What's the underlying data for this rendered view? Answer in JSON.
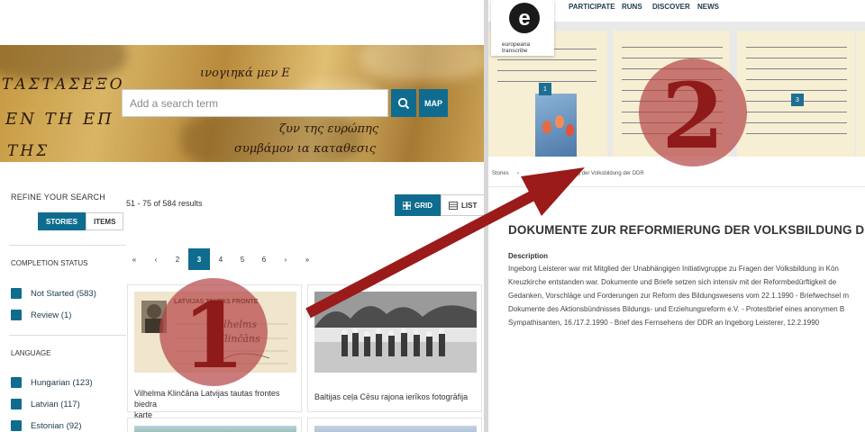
{
  "left": {
    "hero": {
      "handwriting": [
        "ΤΑΣΤΑΣΕΞΟ",
        "ΕΝ ΤΗ ΕΠ",
        "ΤΗΣ",
        "ινογιηκά μεν Ε",
        "ζυν της ευρώπης",
        "συμβάμον ια καταθεσις"
      ]
    },
    "search": {
      "placeholder": "Add a search term",
      "search_icon": "magnifier-icon",
      "map_label": "MAP"
    },
    "sidebar": {
      "refine_title": "REFINE YOUR SEARCH",
      "toggle": {
        "stories": "STORIES",
        "items": "ITEMS"
      },
      "completion_title": "COMPLETION STATUS",
      "completion": [
        {
          "label": "Not Started (583)"
        },
        {
          "label": "Review (1)"
        }
      ],
      "language_title": "LANGUAGE",
      "languages": [
        {
          "label": "Hungarian (123)"
        },
        {
          "label": "Latvian (117)"
        },
        {
          "label": "Estonian (92)"
        }
      ]
    },
    "results": {
      "count": "51 - 75 of 584 results",
      "grid_label": "GRID",
      "list_label": "LIST",
      "pagination": [
        "«",
        "‹",
        "2",
        "3",
        "4",
        "5",
        "6",
        "›",
        "»"
      ],
      "current_page": "3",
      "cards": [
        {
          "title_line1": "Vilhelma Klinčāna Latvijas tautas frontes biedra",
          "title_line2": "karte",
          "thumb_text": [
            "LATVIJAS TAUTAS FRONTE",
            "Vilhelms",
            "Klinčāns"
          ]
        },
        {
          "title_line1": "Baltijas ceļa Cēsu rajona ierīkos fotogrāfija",
          "title_line2": ""
        }
      ]
    },
    "annotation_number": "1"
  },
  "right": {
    "logo": {
      "line1": "europeana",
      "line2": "transcribe"
    },
    "nav": [
      "PARTICIPATE",
      "RUNS",
      "DISCOVER",
      "NEWS"
    ],
    "gallery_badges": [
      "1",
      "3"
    ],
    "breadcrumb": {
      "root": "Stories",
      "sep": "›",
      "current": "…rung der Volksbildung der DDR"
    },
    "story_title": "DOKUMENTE ZUR REFORMIERUNG DER VOLKSBILDUNG DER DDR",
    "description_label": "Description",
    "description_lines": [
      "Ingeborg Leisterer war mit Mitglied der Unabhängigen Initiativgruppe zu Fragen der Volksbildung in Kön",
      "Kreuzkirche entstanden war. Dokumente und Briefe setzen sich intensiv mit der Reformbedürftigkeit de",
      "Gedanken, Vorschläge und Forderungen zur Reform des Bildungswesens vom 22.1.1990 - Briefwechsel m",
      "Dokumente des Aktionsbündnisses Bildungs- und Erziehungsreform e.V. - Protestbrief eines anonymen B",
      "Sympathisanten, 16./17.2.1990 - Brief des Fernsehens der DDR an Ingeborg Leisterer, 12.2.1990"
    ],
    "annotation_number": "2"
  },
  "colors": {
    "accent": "#0f6c8f",
    "annotation_red": "#9b1b1b",
    "annotation_circle": "#b34444"
  }
}
